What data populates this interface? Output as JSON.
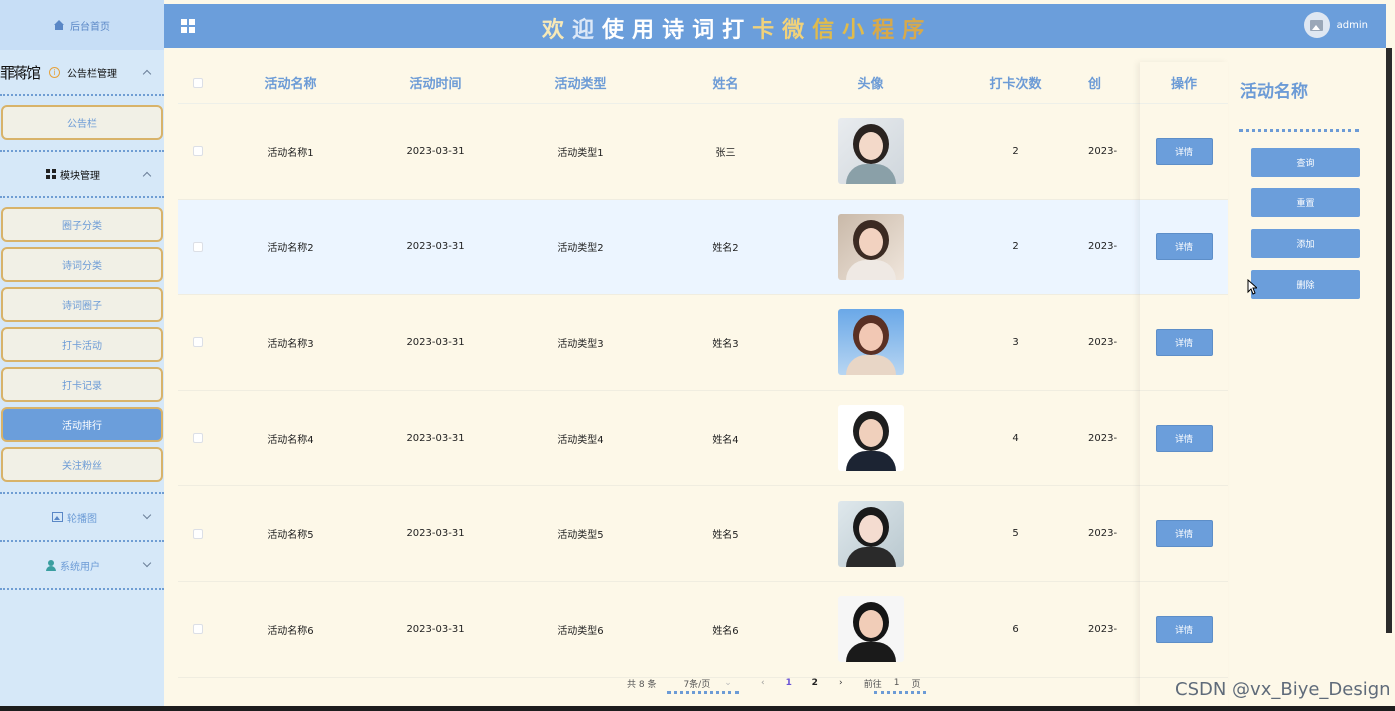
{
  "sidebar": {
    "home_label": "后台首页",
    "groups": [
      {
        "overflow_text": "罪蒋馆",
        "label": "公告栏管理",
        "items": [
          {
            "label": "公告栏",
            "active": false
          }
        ]
      },
      {
        "label": "模块管理",
        "items": [
          {
            "label": "圈子分类",
            "active": false
          },
          {
            "label": "诗词分类",
            "active": false
          },
          {
            "label": "诗词圈子",
            "active": false
          },
          {
            "label": "打卡活动",
            "active": false
          },
          {
            "label": "打卡记录",
            "active": false
          },
          {
            "label": "活动排行",
            "active": true
          },
          {
            "label": "关注粉丝",
            "active": false
          }
        ]
      },
      {
        "label": "轮播图"
      },
      {
        "label": "系统用户"
      }
    ]
  },
  "header": {
    "title_chars": [
      "欢",
      "迎",
      "使",
      "用",
      "诗",
      "词",
      "打",
      "卡",
      "微",
      "信",
      "小",
      "程",
      "序"
    ],
    "title_colors": [
      "#f7e9b7",
      "#dce8f7",
      "#ffffff",
      "#ffffff",
      "#ffffff",
      "#ffffff",
      "#ffffff",
      "#f1d27a",
      "#f1d27a",
      "#e0bb4c",
      "#e0bb4c",
      "#d8a94a",
      "#d8a94a"
    ],
    "username": "admin"
  },
  "table": {
    "columns": [
      "活动名称",
      "活动时间",
      "活动类型",
      "姓名",
      "头像",
      "打卡次数",
      "创"
    ],
    "op_header": "操作",
    "detail_label": "详情",
    "rows": [
      {
        "name": "活动名称1",
        "time": "2023-03-31",
        "type": "活动类型1",
        "person": "张三",
        "count": "2",
        "created": "2023-"
      },
      {
        "name": "活动名称2",
        "time": "2023-03-31",
        "type": "活动类型2",
        "person": "姓名2",
        "count": "2",
        "created": "2023-"
      },
      {
        "name": "活动名称3",
        "time": "2023-03-31",
        "type": "活动类型3",
        "person": "姓名3",
        "count": "3",
        "created": "2023-"
      },
      {
        "name": "活动名称4",
        "time": "2023-03-31",
        "type": "活动类型4",
        "person": "姓名4",
        "count": "4",
        "created": "2023-"
      },
      {
        "name": "活动名称5",
        "time": "2023-03-31",
        "type": "活动类型5",
        "person": "姓名5",
        "count": "5",
        "created": "2023-"
      },
      {
        "name": "活动名称6",
        "time": "2023-03-31",
        "type": "活动类型6",
        "person": "姓名6",
        "count": "6",
        "created": "2023-"
      }
    ]
  },
  "search_panel": {
    "title": "活动名称",
    "buttons": [
      "查询",
      "重置",
      "添加",
      "删除"
    ]
  },
  "pagination": {
    "total": "共 8 条",
    "page_size": "7条/页",
    "pages": [
      "1",
      "2"
    ],
    "current_page": "1",
    "goto_label": "前往",
    "goto_value": "1",
    "page_unit": "页"
  },
  "watermark": "CSDN @vx_Biye_Design"
}
